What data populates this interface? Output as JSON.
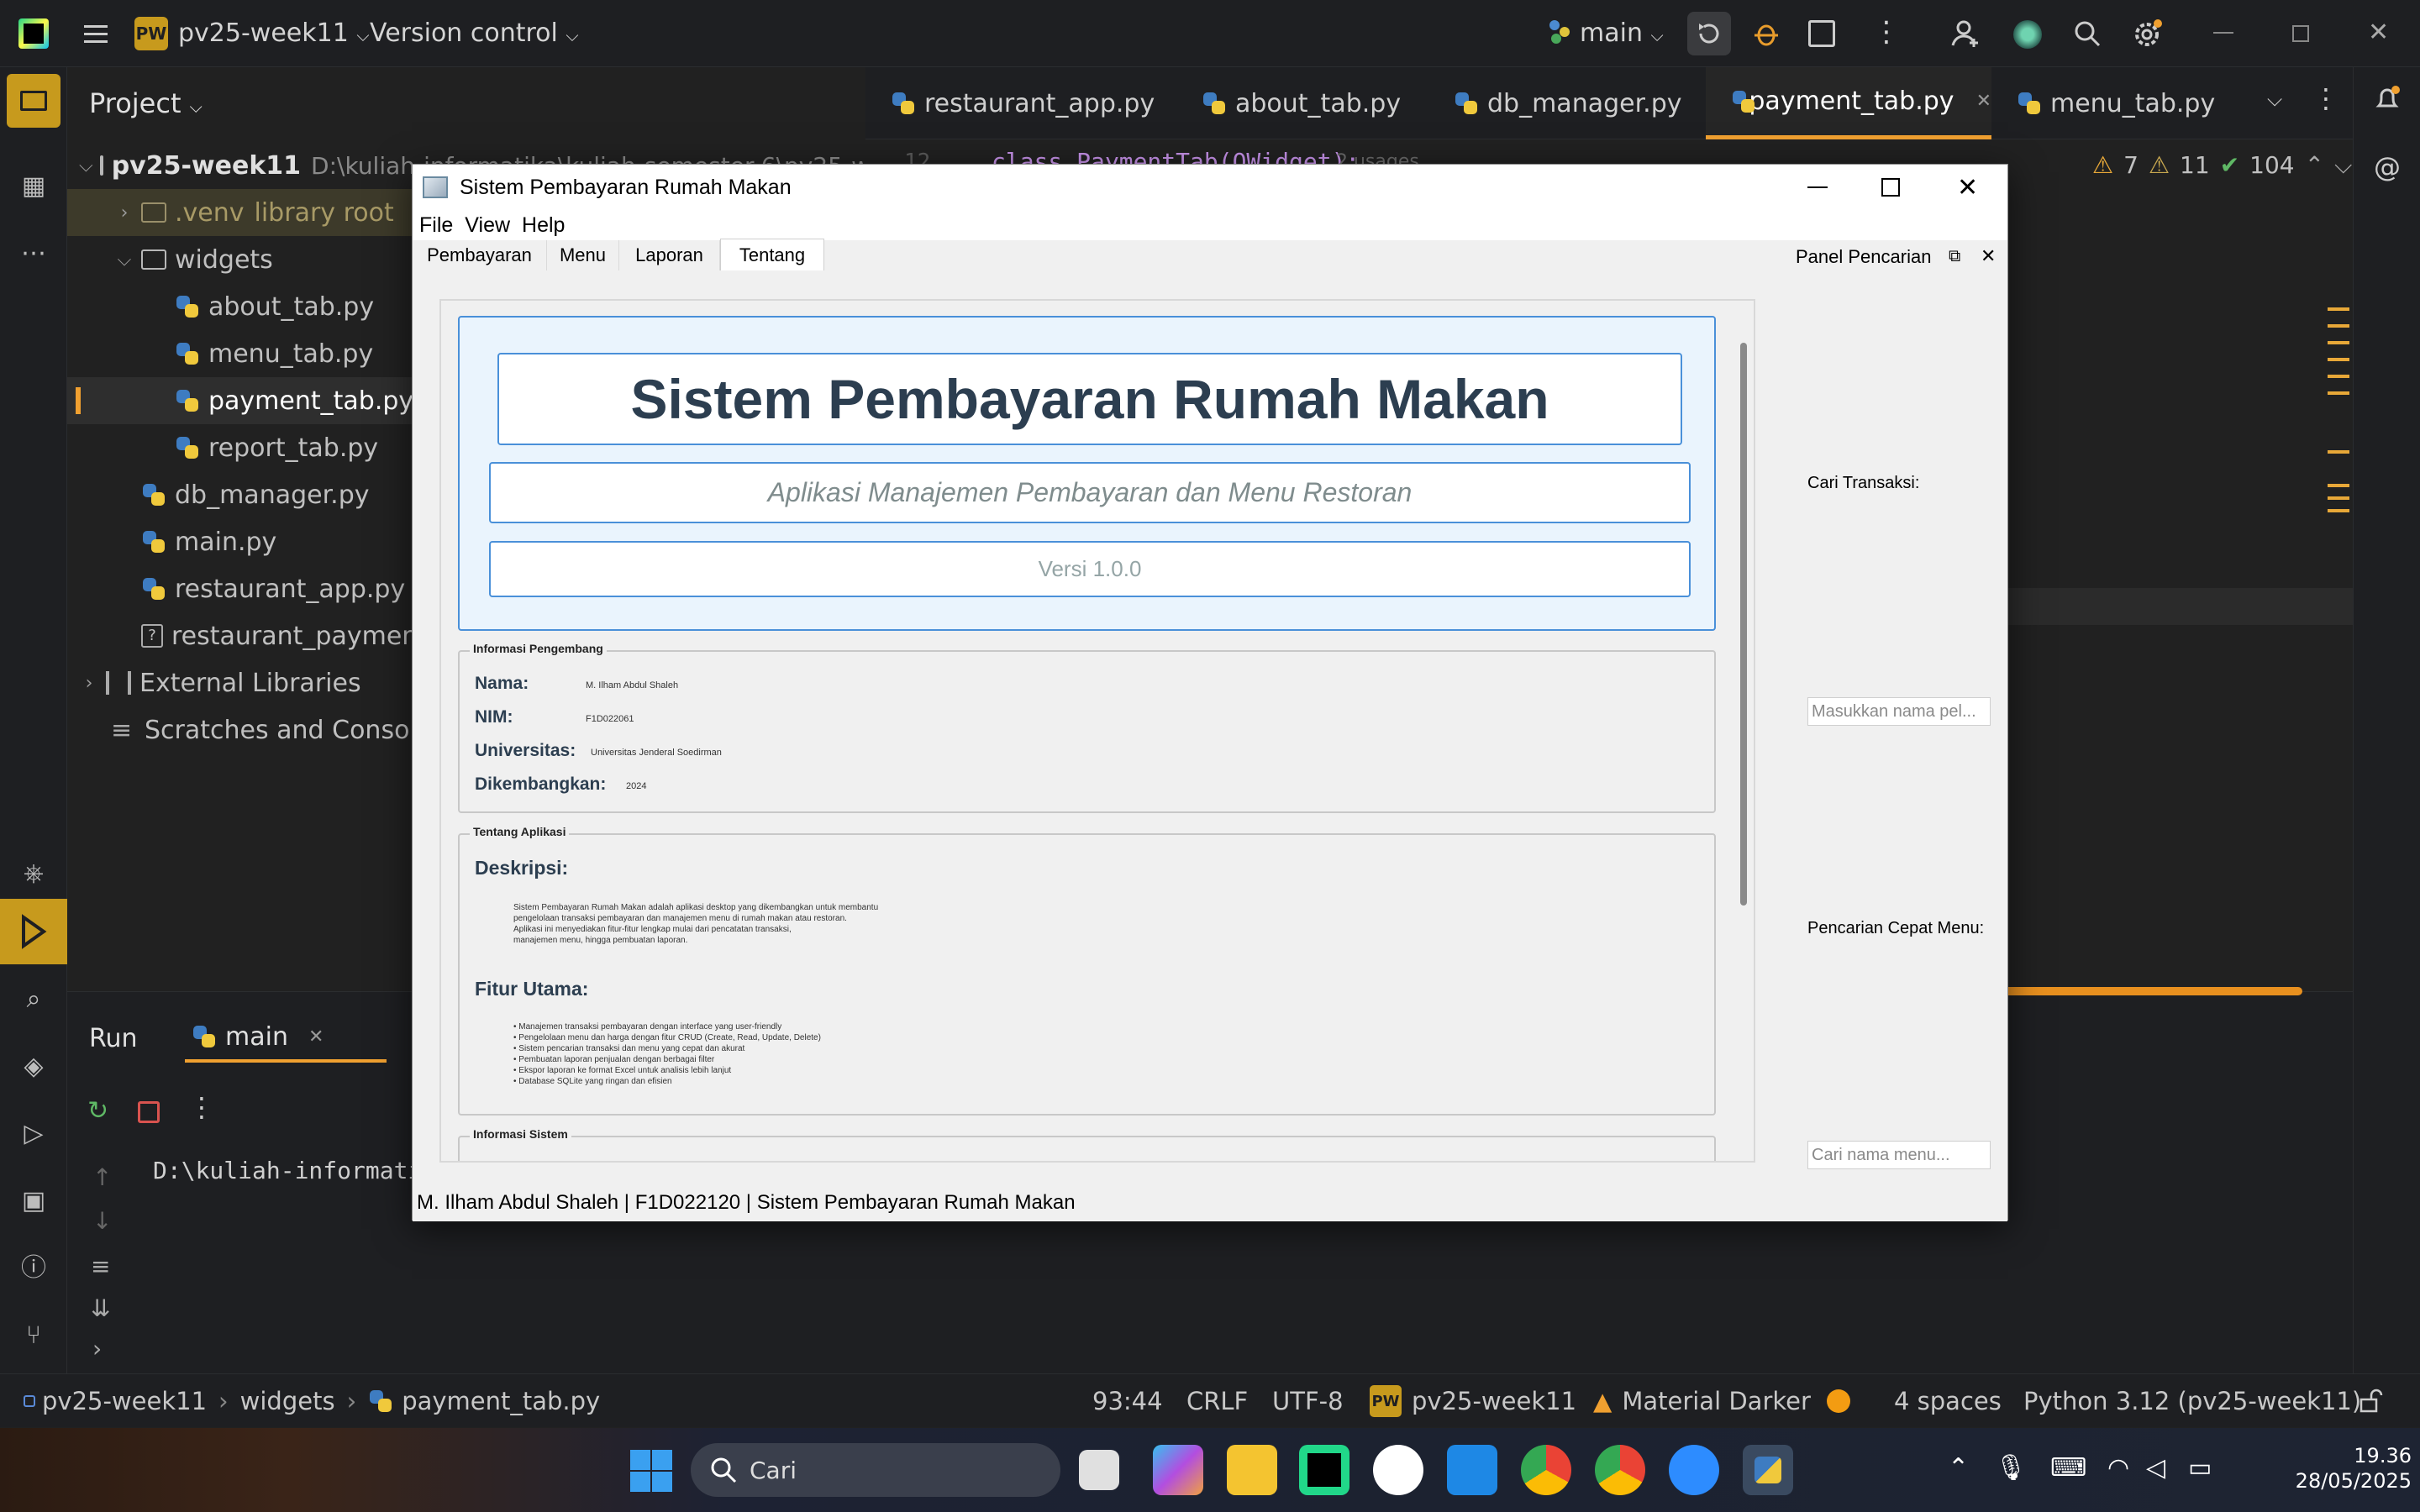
{
  "ide": {
    "project_name": "pv25-week11",
    "project_badge": "PW",
    "vcs_label": "Version control",
    "branch": "main",
    "project_panel_title": "Project",
    "tree": [
      {
        "label": "pv25-week11",
        "extra": "D:\\kuliah-informatika\\kuliah-semester-6\\pv25-we",
        "type": "folder"
      },
      {
        "label": ".venv",
        "extra": "library root",
        "type": "folder"
      },
      {
        "label": "widgets",
        "type": "folder"
      },
      {
        "label": "about_tab.py",
        "type": "py"
      },
      {
        "label": "menu_tab.py",
        "type": "py"
      },
      {
        "label": "payment_tab.py",
        "type": "py"
      },
      {
        "label": "report_tab.py",
        "type": "py"
      },
      {
        "label": "db_manager.py",
        "type": "py"
      },
      {
        "label": "main.py",
        "type": "py"
      },
      {
        "label": "restaurant_app.py",
        "type": "py"
      },
      {
        "label": "restaurant_payment.db",
        "type": "file"
      },
      {
        "label": "External Libraries",
        "type": "lib"
      },
      {
        "label": "Scratches and Consoles",
        "type": "lib"
      }
    ],
    "editor_tabs": [
      "restaurant_app.py",
      "about_tab.py",
      "db_manager.py",
      "payment_tab.py",
      "menu_tab.py"
    ],
    "active_tab": "payment_tab.py",
    "code_line_number": "12",
    "code_snippet": "class PaymentTab(QWidget):",
    "code_usages": "2 usages",
    "inspections": {
      "warnings": "7",
      "weak_warnings": "11",
      "ok": "104"
    },
    "run": {
      "title": "Run",
      "config": "main",
      "output": "D:\\kuliah-informatika\\kuliah-semester-6\\pv25-week11\\.venv\\Scripts\\python.exe"
    },
    "status": {
      "breadcrumb": [
        "pv25-week11",
        "widgets",
        "payment_tab.py"
      ],
      "position": "93:44",
      "line_sep": "CRLF",
      "encoding": "UTF-8",
      "project": "pv25-week11",
      "theme": "Material Darker",
      "indent": "4 spaces",
      "interpreter": "Python 3.12 (pv25-week11)"
    }
  },
  "app": {
    "window_title": "Sistem Pembayaran Rumah Makan",
    "menu": [
      "File",
      "View",
      "Help"
    ],
    "tabs": [
      "Pembayaran",
      "Menu",
      "Laporan",
      "Tentang"
    ],
    "active_tab": "Tentang",
    "title": "Sistem Pembayaran Rumah Makan",
    "subtitle": "Aplikasi Manajemen Pembayaran dan Menu Restoran",
    "version": "Versi 1.0.0",
    "dev_group": "Informasi Pengembang",
    "dev": [
      {
        "label": "Nama:",
        "value": "M. Ilham Abdul Shaleh"
      },
      {
        "label": "NIM:",
        "value": "F1D022061"
      },
      {
        "label": "Universitas:",
        "value": "Universitas Jenderal Soedirman"
      },
      {
        "label": "Dikembangkan:",
        "value": "2024"
      }
    ],
    "about_group": "Tentang Aplikasi",
    "desc_title": "Deskripsi:",
    "desc_text": "Sistem Pembayaran Rumah Makan adalah aplikasi desktop yang dikembangkan untuk membantu\npengelolaan transaksi pembayaran dan manajemen menu di rumah makan atau restoran.\nAplikasi ini menyediakan fitur-fitur lengkap mulai dari pencatatan transaksi,\nmanajemen menu, hingga pembuatan laporan.",
    "features_title": "Fitur Utama:",
    "features_text": "• Manajemen transaksi pembayaran dengan interface yang user-friendly\n• Pengelolaan menu dan harga dengan fitur CRUD (Create, Read, Update, Delete)\n• Sistem pencarian transaksi dan menu yang cepat dan akurat\n• Pembuatan laporan penjualan dengan berbagai filter\n• Ekspor laporan ke format Excel untuk analisis lebih lanjut\n• Database SQLite yang ringan dan efisien",
    "sys_group": "Informasi Sistem",
    "dock_title": "Panel Pencarian",
    "search_tx_label": "Cari Transaksi:",
    "search_tx_placeholder": "Masukkan nama pel...",
    "search_menu_label": "Pencarian Cepat Menu:",
    "search_menu_placeholder": "Cari nama menu...",
    "statusbar": "M. Ilham Abdul Shaleh | F1D022120 | Sistem Pembayaran Rumah Makan"
  },
  "taskbar": {
    "search_label": "Cari",
    "time": "19.36",
    "date": "28/05/2025"
  },
  "colors": {
    "accent_blue": "#4a90d9",
    "title_dark": "#2c3e50",
    "ide_bg": "#212121",
    "tab_active_underline": "#f0a030"
  }
}
